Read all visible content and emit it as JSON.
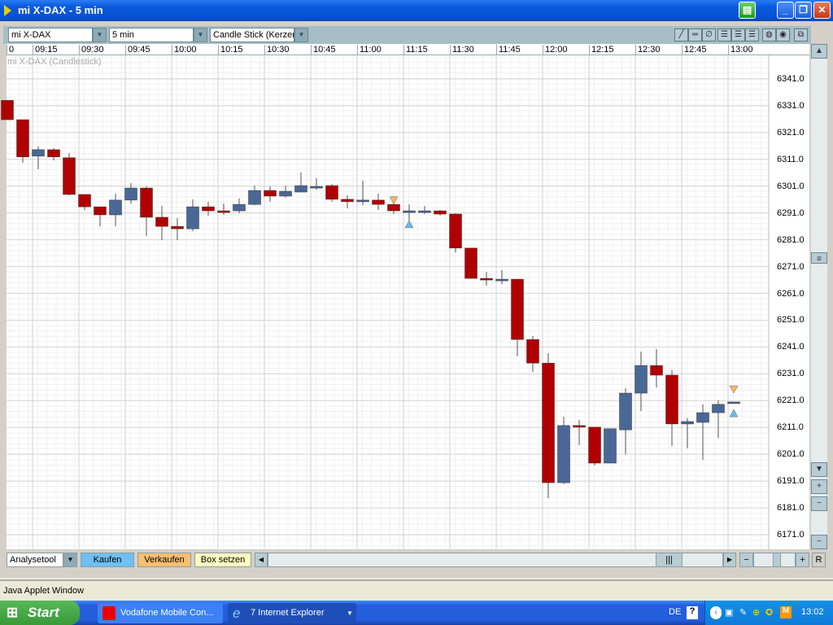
{
  "window": {
    "title": "mi X-DAX - 5 min"
  },
  "toolbar": {
    "symbol": "mi X-DAX",
    "interval": "5 min",
    "chart_type": "Candle Stick (Kerzen"
  },
  "chart": {
    "label": "mi X-DAX (Candlestick)",
    "time_labels": [
      "0",
      "09:15",
      "09:30",
      "09:45",
      "10:00",
      "10:15",
      "10:30",
      "10:45",
      "11:00",
      "11:15",
      "11:30",
      "11:45",
      "12:00",
      "12:15",
      "12:30",
      "12:45",
      "13:00"
    ],
    "price_labels": [
      "6341.0",
      "6331.0",
      "6321.0",
      "6311.0",
      "6301.0",
      "6291.0",
      "6281.0",
      "6271.0",
      "6261.0",
      "6251.0",
      "6241.0",
      "6231.0",
      "6221.0",
      "6211.0",
      "6201.0",
      "6191.0",
      "6181.0",
      "6171.0"
    ],
    "colors": {
      "up": "#4a6896",
      "down": "#b00000",
      "buy_marker": "#6fb7e8",
      "sell_marker": "#f5b860"
    }
  },
  "chart_data": {
    "type": "candlestick",
    "interval_min": 5,
    "first_time": "09:05",
    "ylim": [
      6166,
      6350
    ],
    "ohlc": [
      [
        6333,
        6333,
        6325.8,
        6325.8
      ],
      [
        6325.8,
        6325.8,
        6309.7,
        6311.9
      ],
      [
        6312.2,
        6315.8,
        6307.3,
        6314.6
      ],
      [
        6314.6,
        6315.2,
        6310.6,
        6311.9
      ],
      [
        6311.6,
        6313.4,
        6297.6,
        6297.9
      ],
      [
        6297.9,
        6297.9,
        6292.1,
        6293.3
      ],
      [
        6293.3,
        6293.3,
        6286,
        6290.3
      ],
      [
        6290.3,
        6298.2,
        6286,
        6295.8
      ],
      [
        6295.8,
        6302.1,
        6294.5,
        6300.3
      ],
      [
        6300.3,
        6300.9,
        6282.4,
        6289.4
      ],
      [
        6289.4,
        6293.6,
        6280.9,
        6286
      ],
      [
        6286,
        6289.1,
        6280.9,
        6285.1
      ],
      [
        6285.1,
        6296.1,
        6284.2,
        6293.3
      ],
      [
        6293.3,
        6295.2,
        6290,
        6291.8
      ],
      [
        6291.8,
        6294.5,
        6290.3,
        6291.5
      ],
      [
        6291.8,
        6296.4,
        6290.9,
        6294.2
      ],
      [
        6294.2,
        6301.2,
        6293.9,
        6299.4
      ],
      [
        6299.4,
        6300.9,
        6295.2,
        6297.3
      ],
      [
        6297.3,
        6301.2,
        6296.7,
        6299.1
      ],
      [
        6298.8,
        6306.1,
        6298.8,
        6301.2
      ],
      [
        6300.9,
        6304,
        6299.7,
        6300.9
      ],
      [
        6301.2,
        6301.8,
        6295.2,
        6296.1
      ],
      [
        6296.1,
        6297.6,
        6292.7,
        6295.2
      ],
      [
        6295.2,
        6303,
        6293.9,
        6295.8
      ],
      [
        6295.8,
        6298.2,
        6292.1,
        6294.2
      ],
      [
        6294.2,
        6297.3,
        6290.6,
        6291.8
      ],
      [
        6291.8,
        6294.2,
        6288.2,
        6291.8
      ],
      [
        6291.8,
        6293.6,
        6290.6,
        6291.8
      ],
      [
        6291.8,
        6292.1,
        6290,
        6290.6
      ],
      [
        6290.6,
        6290.9,
        6276.3,
        6277.9
      ],
      [
        6277.9,
        6277.9,
        6266.6,
        6266.6
      ],
      [
        6266.6,
        6269,
        6263.9,
        6266
      ],
      [
        6265.7,
        6269.7,
        6264.5,
        6266.3
      ],
      [
        6266.3,
        6266.3,
        6237.5,
        6243.8
      ],
      [
        6243.8,
        6245.1,
        6231.7,
        6235
      ],
      [
        6235,
        6238.7,
        6184.6,
        6190.4
      ],
      [
        6190.4,
        6215,
        6189.8,
        6211.7
      ],
      [
        6211.7,
        6213.8,
        6204.4,
        6211.1
      ],
      [
        6211.1,
        6211.1,
        6196.8,
        6197.7
      ],
      [
        6197.7,
        6210.5,
        6197.7,
        6210.5
      ],
      [
        6210.1,
        6225.6,
        6201,
        6223.8
      ],
      [
        6223.8,
        6239.3,
        6217.1,
        6234.1
      ],
      [
        6234.1,
        6240.2,
        6225.9,
        6230.5
      ],
      [
        6230.5,
        6232.3,
        6204.1,
        6212.3
      ],
      [
        6212.3,
        6214.5,
        6203.2,
        6213.2
      ],
      [
        6212.9,
        6219.6,
        6198.9,
        6216.5
      ],
      [
        6216.5,
        6221.1,
        6207.1,
        6219.6
      ],
      [
        6220.2,
        6220.5,
        6220.2,
        6220.5
      ]
    ],
    "markers": [
      {
        "index": 25,
        "type": "sell",
        "price": 6295.5
      },
      {
        "index": 26,
        "type": "buy",
        "price": 6287
      },
      {
        "index": 47,
        "type": "sell",
        "price": 6225
      },
      {
        "index": 47,
        "type": "buy",
        "price": 6216.5
      }
    ]
  },
  "bottom": {
    "tool": "Analysetool",
    "buy": "Kaufen",
    "sell": "Verkaufen",
    "box": "Box setzen",
    "reset": "R"
  },
  "status": "Java Applet Window",
  "taskbar": {
    "start": "Start",
    "tasks": [
      "Vodafone Mobile Con...",
      "7 Internet Explorer"
    ],
    "lang": "DE",
    "clock": "13:02"
  }
}
